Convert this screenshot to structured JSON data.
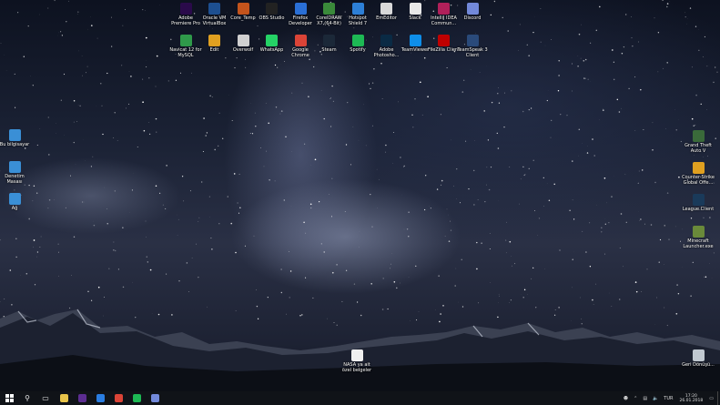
{
  "desktop_icons": {
    "top_row1": [
      {
        "label": "Adobe Premiere Pro",
        "icon": "premiere-icon",
        "color": "#2a0a4a"
      },
      {
        "label": "Oracle VM VirtualBox",
        "icon": "virtualbox-icon",
        "color": "#1d4f91"
      },
      {
        "label": "Core_Temp",
        "icon": "coretemp-icon",
        "color": "#c4541c"
      },
      {
        "label": "OBS Studio",
        "icon": "obs-icon",
        "color": "#222222"
      },
      {
        "label": "Firefox Developer",
        "icon": "firefox-dev-icon",
        "color": "#2a6fd6"
      },
      {
        "label": "CorelDRAW X7 (64-Bit)",
        "icon": "coreldraw-icon",
        "color": "#3a8a3a"
      },
      {
        "label": "Hotspot Shield 7",
        "icon": "hotspot-shield-icon",
        "color": "#2d7fd6"
      },
      {
        "label": "EmEditor",
        "icon": "emeditor-icon",
        "color": "#d9d9d9"
      },
      {
        "label": "Slack",
        "icon": "slack-icon",
        "color": "#e8e8e8"
      },
      {
        "label": "IntelliJ IDEA Commun...",
        "icon": "intellij-icon",
        "color": "#b0205a"
      },
      {
        "label": "Discord",
        "icon": "discord-icon",
        "color": "#7289da"
      }
    ],
    "top_row2": [
      {
        "label": "Navicat 12 for MySQL",
        "icon": "navicat-icon",
        "color": "#2f9a4a"
      },
      {
        "label": "Edit",
        "icon": "edit-icon",
        "color": "#e0a020"
      },
      {
        "label": "Overwolf",
        "icon": "overwolf-icon",
        "color": "#d0d0d0"
      },
      {
        "label": "WhatsApp",
        "icon": "whatsapp-icon",
        "color": "#25d366"
      },
      {
        "label": "Google Chrome",
        "icon": "chrome-icon",
        "color": "#db4437"
      },
      {
        "label": "Steam",
        "icon": "steam-icon",
        "color": "#1b2838"
      },
      {
        "label": "Spotify",
        "icon": "spotify-icon",
        "color": "#1db954"
      },
      {
        "label": "Adobe Photosho...",
        "icon": "photoshop-icon",
        "color": "#0a2a44"
      },
      {
        "label": "TeamViewer",
        "icon": "teamviewer-icon",
        "color": "#0e8ee9"
      },
      {
        "label": "FileZilla Client",
        "icon": "filezilla-icon",
        "color": "#bf0000"
      },
      {
        "label": "TeamSpeak 3 Client",
        "icon": "teamspeak-icon",
        "color": "#2a4a7a"
      }
    ],
    "left": [
      {
        "label": "Bu bilgisayar",
        "icon": "this-pc-icon",
        "color": "#3a8fd6"
      },
      {
        "label": "Denetim Masası",
        "icon": "control-panel-icon",
        "color": "#3a8fd6"
      },
      {
        "label": "Ağ",
        "icon": "network-icon",
        "color": "#3a8fd6"
      }
    ],
    "right": [
      {
        "label": "Grand Theft Auto V",
        "icon": "gta5-icon",
        "color": "#3a6a3a"
      },
      {
        "label": "Counter-Strike Global Offe...",
        "icon": "csgo-icon",
        "color": "#e0a020"
      },
      {
        "label": "League.Client",
        "icon": "league-client-icon",
        "color": "#1a3a5a"
      },
      {
        "label": "Minecraft Launcher.exe",
        "icon": "minecraft-icon",
        "color": "#6a8a3a"
      }
    ],
    "bottom": [
      {
        "label": "NASA ya ait özel belgeler",
        "icon": "document-icon",
        "color": "#f0f0f0"
      },
      {
        "label": "Geri Dönüşü...",
        "icon": "recycle-bin-icon",
        "color": "#c0c8d0"
      }
    ]
  },
  "taskbar": {
    "start_icon": "windows-start-icon",
    "pinned": [
      {
        "icon": "search-icon"
      },
      {
        "icon": "task-view-icon"
      },
      {
        "icon": "file-explorer-icon",
        "color": "#e8c44a"
      },
      {
        "icon": "visual-studio-icon",
        "color": "#5c2d91"
      },
      {
        "icon": "edge-icon",
        "color": "#2a7de1"
      },
      {
        "icon": "chrome-icon",
        "color": "#db4437"
      },
      {
        "icon": "spotify-icon",
        "color": "#1db954"
      },
      {
        "icon": "discord-icon",
        "color": "#7289da"
      }
    ],
    "tray": {
      "language": "TUR",
      "time": "17:20",
      "date": "26.01.2018"
    }
  }
}
